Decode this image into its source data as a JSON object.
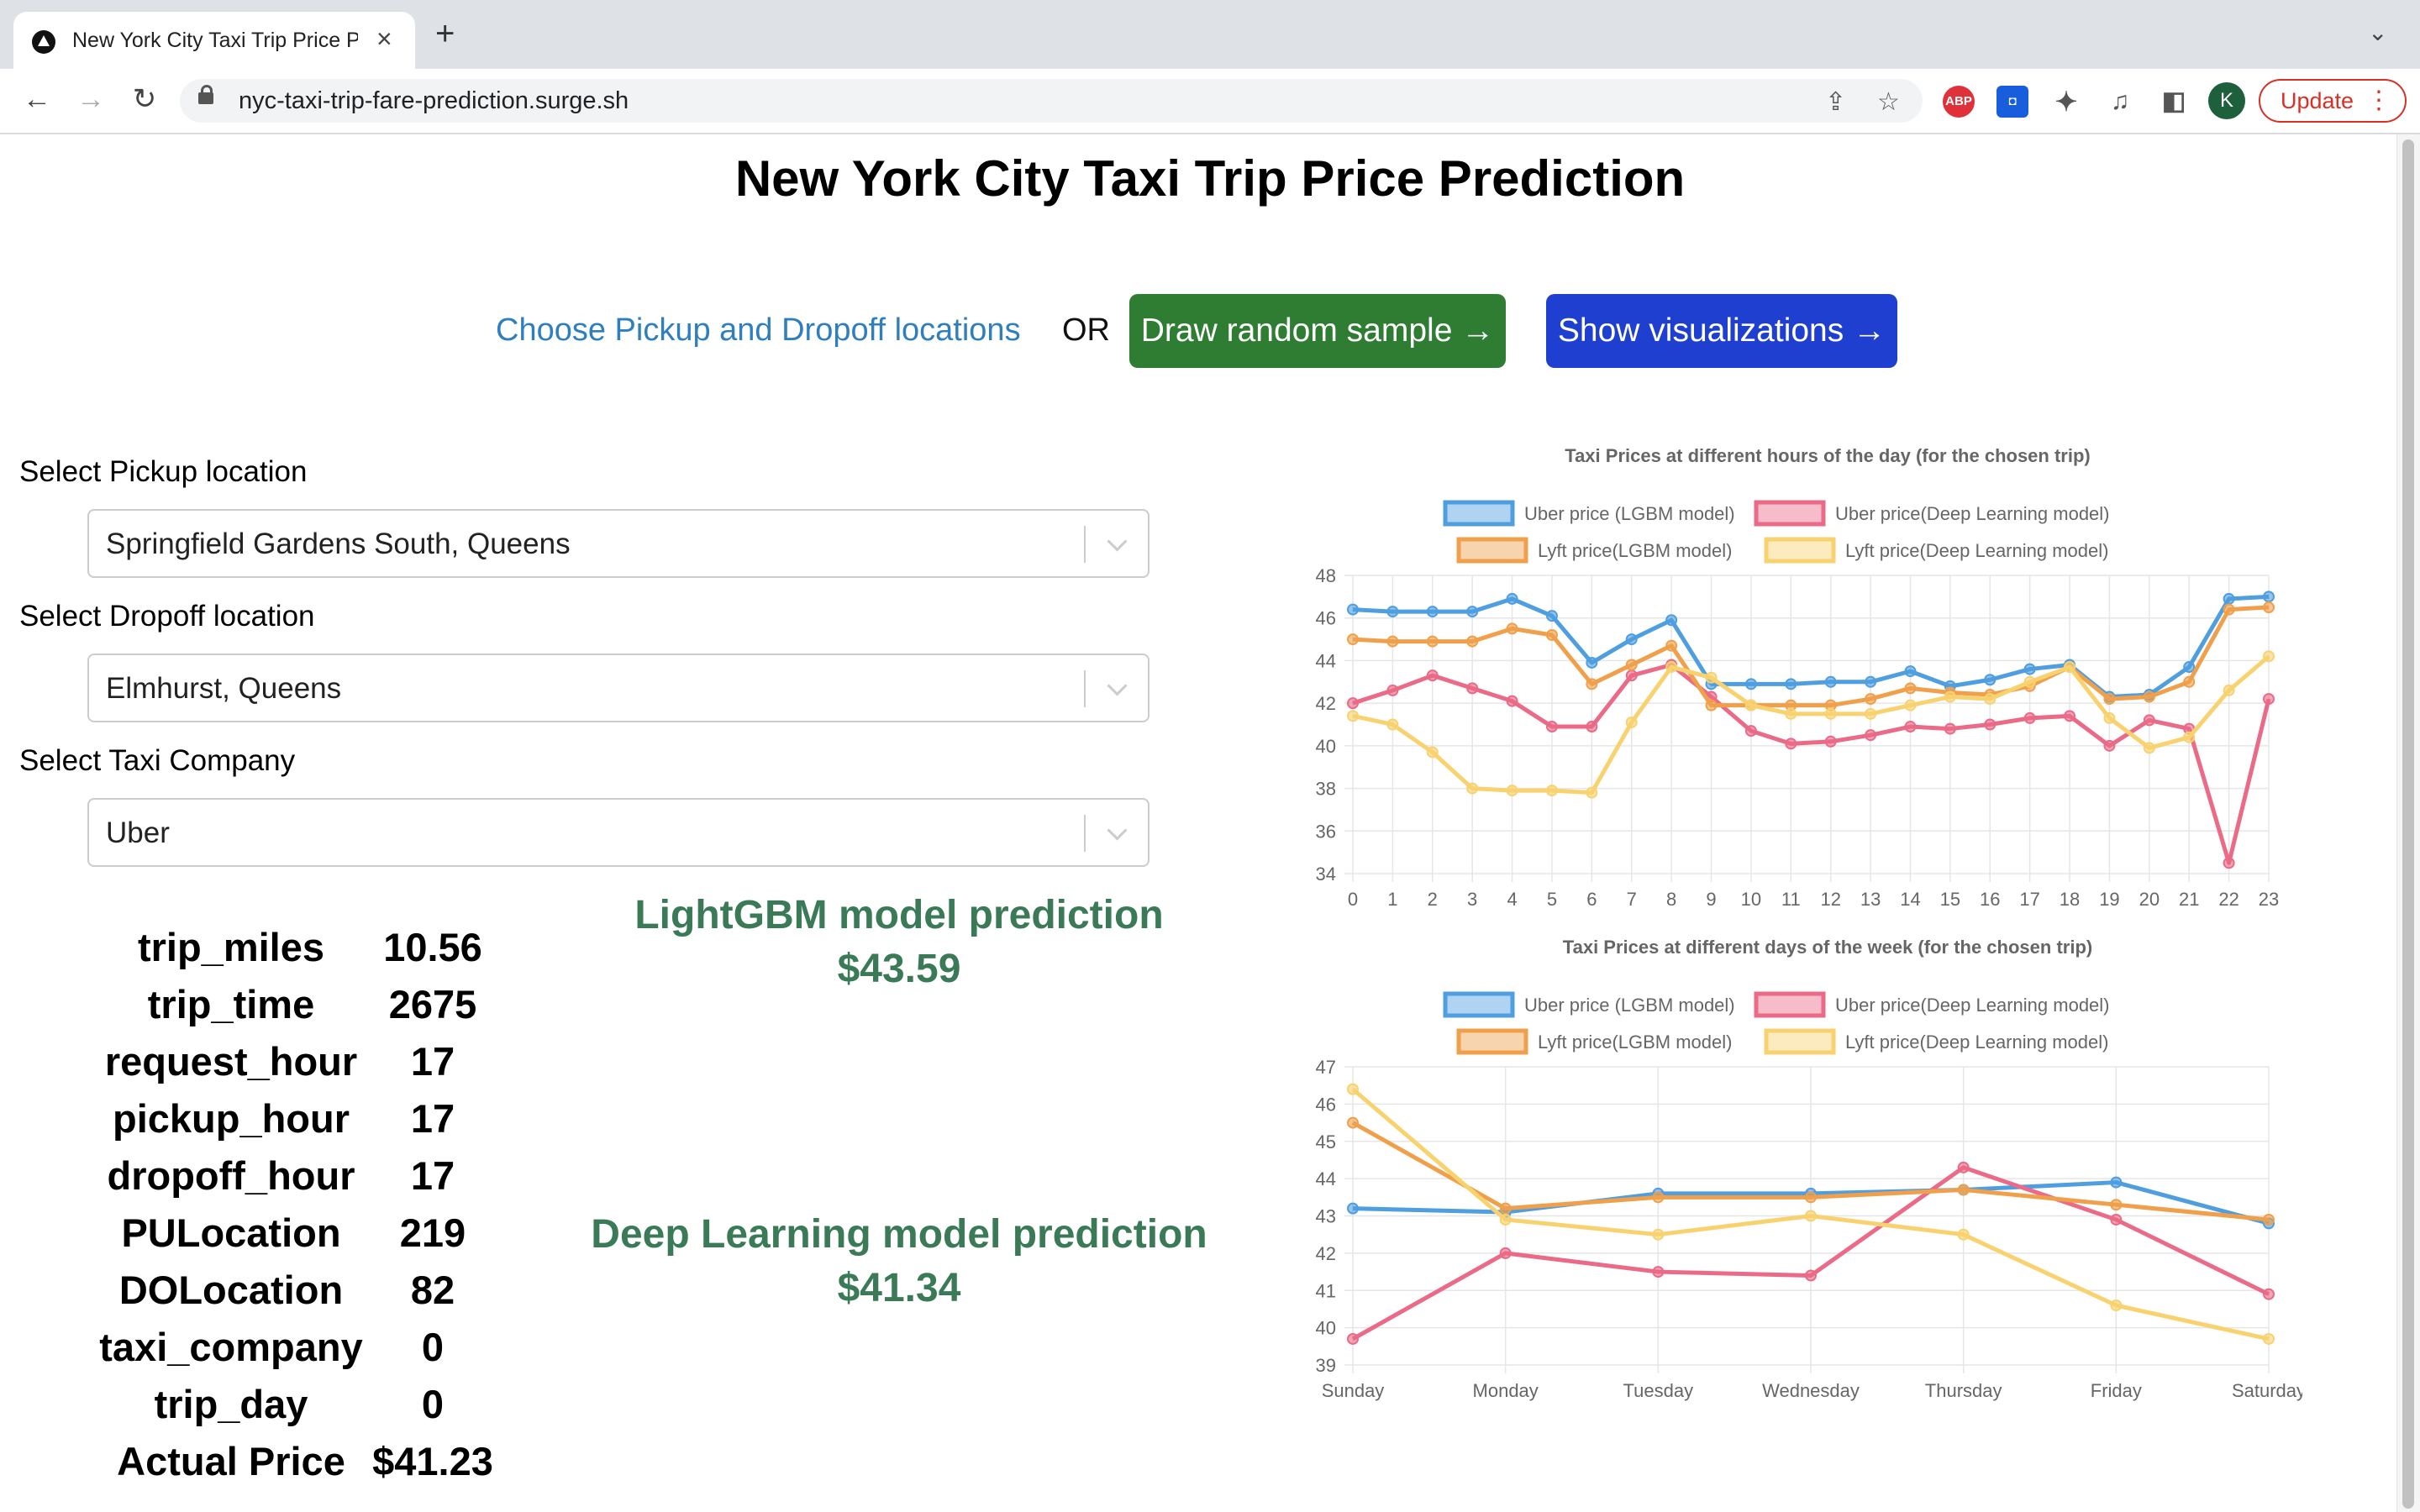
{
  "browser": {
    "tab_title": "New York City Taxi Trip Price Prediction",
    "new_tab": "+",
    "close": "×",
    "url": "nyc-taxi-trip-fare-prediction.surge.sh",
    "profile_initial": "K",
    "update_label": "Update",
    "abp_label": "ABP"
  },
  "page": {
    "title": "New York City Taxi Trip Price Prediction",
    "choose_link": "Choose Pickup and Dropoff locations",
    "or": "OR",
    "random_btn": "Draw random sample →",
    "viz_btn": "Show visualizations →"
  },
  "form": {
    "pickup_label": "Select Pickup location",
    "pickup_value": "Springfield Gardens South, Queens",
    "dropoff_label": "Select Dropoff location",
    "dropoff_value": "Elmhurst, Queens",
    "company_label": "Select Taxi Company",
    "company_value": "Uber"
  },
  "stats": [
    {
      "key": "trip_miles",
      "value": "10.56"
    },
    {
      "key": "trip_time",
      "value": "2675"
    },
    {
      "key": "request_hour",
      "value": "17"
    },
    {
      "key": "pickup_hour",
      "value": "17"
    },
    {
      "key": "dropoff_hour",
      "value": "17"
    },
    {
      "key": "PULocation",
      "value": "219"
    },
    {
      "key": "DOLocation",
      "value": "82"
    },
    {
      "key": "taxi_company",
      "value": "0"
    },
    {
      "key": "trip_day",
      "value": "0"
    },
    {
      "key": "Actual Price",
      "value": "$41.23"
    }
  ],
  "predictions": {
    "lgbm_title": "LightGBM model prediction",
    "lgbm_value": "$43.59",
    "dl_title": "Deep Learning model prediction",
    "dl_value": "$41.34"
  },
  "chart_data": [
    {
      "type": "line",
      "title": "Taxi Prices at different hours of the day (for the chosen trip)",
      "legend_position": "top",
      "grid": true,
      "x": [
        0,
        1,
        2,
        3,
        4,
        5,
        6,
        7,
        8,
        9,
        10,
        11,
        12,
        13,
        14,
        15,
        16,
        17,
        18,
        19,
        20,
        21,
        22,
        23
      ],
      "ylim": [
        34,
        48
      ],
      "yticks": [
        34,
        36,
        38,
        40,
        42,
        44,
        46,
        48
      ],
      "series": [
        {
          "name": "Uber price (LGBM model)",
          "color": "#4f9ee0",
          "values": [
            46.4,
            46.3,
            46.3,
            46.3,
            46.9,
            46.1,
            43.9,
            45.0,
            45.9,
            42.9,
            42.9,
            42.9,
            43.0,
            43.0,
            43.5,
            42.8,
            43.1,
            43.6,
            43.8,
            42.3,
            42.4,
            43.7,
            46.9,
            47.0
          ]
        },
        {
          "name": "Uber price(Deep Learning model)",
          "color": "#ea6a87",
          "values": [
            42.0,
            42.6,
            43.3,
            42.7,
            42.1,
            40.9,
            40.9,
            43.3,
            43.8,
            42.3,
            40.7,
            40.1,
            40.2,
            40.5,
            40.9,
            40.8,
            41.0,
            41.3,
            41.4,
            40.0,
            41.2,
            40.8,
            34.5,
            42.2
          ]
        },
        {
          "name": "Lyft price(LGBM model)",
          "color": "#f0a04b",
          "values": [
            45.0,
            44.9,
            44.9,
            44.9,
            45.5,
            45.2,
            42.9,
            43.8,
            44.7,
            41.9,
            41.9,
            41.9,
            41.9,
            42.2,
            42.7,
            42.5,
            42.4,
            42.8,
            43.7,
            42.2,
            42.3,
            43.0,
            46.4,
            46.5
          ]
        },
        {
          "name": "Lyft price(Deep Learning model)",
          "color": "#f9d270",
          "values": [
            41.4,
            41.0,
            39.7,
            38.0,
            37.9,
            37.9,
            37.8,
            41.1,
            43.7,
            43.2,
            41.9,
            41.5,
            41.5,
            41.5,
            41.9,
            42.3,
            42.2,
            43.0,
            43.7,
            41.3,
            39.9,
            40.4,
            42.6,
            44.2
          ]
        }
      ]
    },
    {
      "type": "line",
      "title": "Taxi Prices at different days of the week (for the chosen trip)",
      "legend_position": "top",
      "grid": true,
      "x": [
        "Sunday",
        "Monday",
        "Tuesday",
        "Wednesday",
        "Thursday",
        "Friday",
        "Saturday"
      ],
      "ylim": [
        39,
        47
      ],
      "yticks": [
        39,
        40,
        41,
        42,
        43,
        44,
        45,
        46,
        47
      ],
      "series": [
        {
          "name": "Uber price (LGBM model)",
          "color": "#4f9ee0",
          "values": [
            43.2,
            43.1,
            43.6,
            43.6,
            43.7,
            43.9,
            42.8
          ]
        },
        {
          "name": "Uber price(Deep Learning model)",
          "color": "#ea6a87",
          "values": [
            39.7,
            42.0,
            41.5,
            41.4,
            44.3,
            42.9,
            40.9
          ]
        },
        {
          "name": "Lyft price(LGBM model)",
          "color": "#f0a04b",
          "values": [
            45.5,
            43.2,
            43.5,
            43.5,
            43.7,
            43.3,
            42.9
          ]
        },
        {
          "name": "Lyft price(Deep Learning model)",
          "color": "#f9d270",
          "values": [
            46.4,
            42.9,
            42.5,
            43.0,
            42.5,
            40.6,
            39.7
          ]
        }
      ]
    }
  ]
}
